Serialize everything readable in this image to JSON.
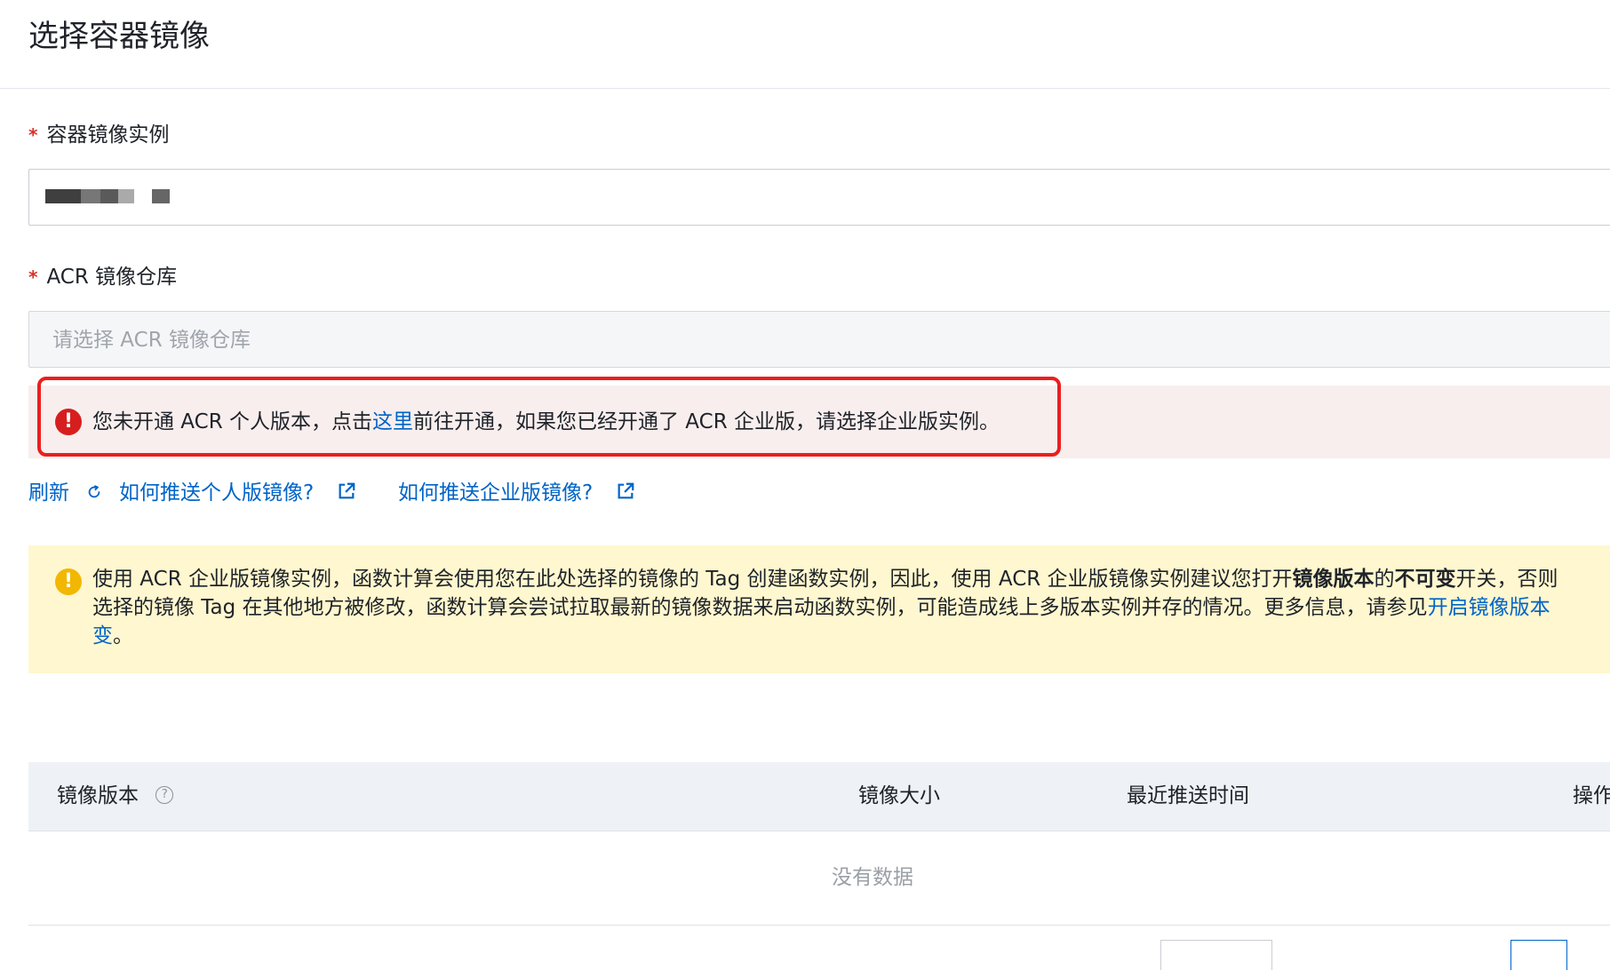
{
  "header": {
    "title": "选择容器镜像"
  },
  "form": {
    "instance": {
      "required_mark": "*",
      "label": "容器镜像实例"
    },
    "repository": {
      "required_mark": "*",
      "label": "ACR 镜像仓库",
      "placeholder": "请选择 ACR 镜像仓库"
    }
  },
  "error_alert": {
    "icon": "error-icon",
    "text_before": "您未开通 ACR 个人版本，点击",
    "link_text": "这里",
    "text_after": "前往开通，如果您已经开通了 ACR 企业版，请选择企业版实例。",
    "highlight_color": "#ea1f1f"
  },
  "actions": {
    "refresh_label": "刷新",
    "personal_push_label": "如何推送个人版镜像?",
    "enterprise_push_label": "如何推送企业版镜像?"
  },
  "warning_alert": {
    "icon": "warning-icon",
    "line1_before": "使用 ACR 企业版镜像实例，函数计算会使用您在此处选择的镜像的 Tag 创建函数实例，因此，使用 ACR 企业版镜像实例建议您打开",
    "line1_strong1": "镜像版本",
    "line1_middle": "的",
    "line1_strong2": "不可变",
    "line1_after": "开关，否则",
    "line2": "选择的镜像 Tag 在其他地方被修改，函数计算会尝试拉取最新的镜像数据来启动函数实例，可能造成线上多版本实例并存的情况。更多信息，请参见",
    "line2_link": "开启镜像版本",
    "line3_link": "变",
    "line3_after": "。"
  },
  "table": {
    "columns": [
      "镜像版本",
      "镜像大小",
      "最近推送时间",
      "操作"
    ],
    "help_symbol": "?",
    "empty_text": "没有数据"
  },
  "colors": {
    "primary_link": "#0064c8",
    "error_red": "#d71e1e",
    "warning_yellow": "#f2b700",
    "table_header_bg": "#eef2f7"
  }
}
